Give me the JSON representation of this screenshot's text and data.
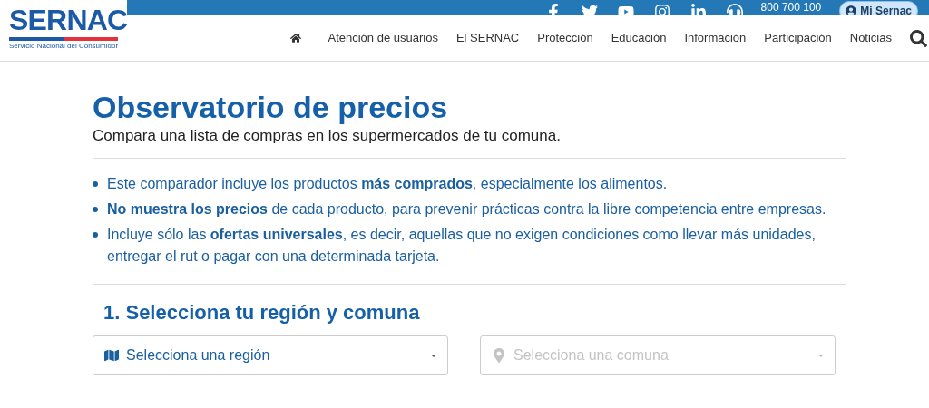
{
  "logo": {
    "name": "SERNAC",
    "tagline": "Servicio Nacional del Consumidor"
  },
  "top_bar": {
    "phone": "800 700 100",
    "account_button": "Mi Sernac"
  },
  "nav": {
    "items": [
      "Atención de usuarios",
      "El SERNAC",
      "Protección",
      "Educación",
      "Información",
      "Participación",
      "Noticias"
    ]
  },
  "page": {
    "title": "Observatorio de precios",
    "subtitle": "Compara una lista de compras en los supermercados de tu comuna.",
    "bullets": [
      "Este comparador incluye los productos **más comprados**, especialmente los alimentos.",
      "**No muestra los precios** de cada producto, para prevenir prácticas contra la libre competencia entre empresas.",
      "Incluye sólo las **ofertas universales**, es decir, aquellas que no exigen condiciones como llevar más unidades, entregar el rut o pagar con una determinada tarjeta."
    ]
  },
  "step": {
    "heading": "1. Selecciona tu región y comuna",
    "selects": [
      {
        "kind": "map",
        "placeholder": "Selecciona una región",
        "disabled": false
      },
      {
        "kind": "pin",
        "placeholder": "Selecciona una comuna",
        "disabled": true
      }
    ]
  }
}
